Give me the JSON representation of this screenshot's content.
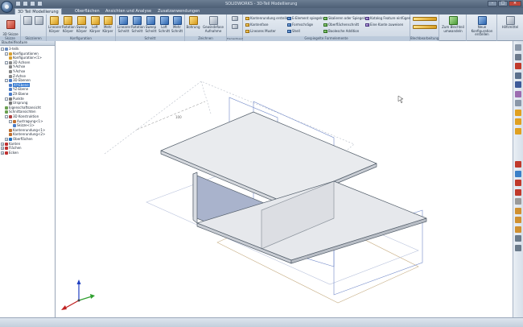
{
  "window": {
    "title": "SOLIDWORKS - 3D-Teil Modellierung",
    "min": "–",
    "max": "□",
    "close": "×"
  },
  "tabs": [
    "3D Teil Modellierung",
    "Oberflächen",
    "Ansichten und Analyse",
    "Zusatzanwendungen"
  ],
  "ribbon": {
    "groups": [
      {
        "label": "Skizze"
      },
      {
        "label": "Skizzieren"
      },
      {
        "label": "Konfiguration"
      },
      {
        "label": "Schnitt"
      },
      {
        "label": "Zeichnen"
      },
      {
        "label": "Elementbearbeitung"
      },
      {
        "label": "Gespiegelte Formelemente"
      },
      {
        "label": "Blechbearbeitung"
      },
      {
        "label": "Hilfsmittel"
      }
    ],
    "sketch_btn": "3D Skizze\naktivieren",
    "buttons_1": [
      "Linearer\nKörper",
      "Rotation\nKörper",
      "Sweep\nKörper",
      "Loft\nKörper",
      "Mehr\nKörper"
    ],
    "buttons_2": [
      "Linearer\nSchnitt",
      "Rotation\nSchnitt",
      "Sweep\nSchnitt",
      "Loft\nSchnitt",
      "Mehr\nSchnitt"
    ],
    "buttons_3": [
      "Bohrung",
      "Gewindefase\nAufnahme"
    ],
    "small_col1": [
      "Kantenrundung erstellen",
      "Kantenfase",
      "Lineares Muster"
    ],
    "small_col2": [
      "E-Element spiegeln",
      "Formschräge",
      "Shell"
    ],
    "small_col3": [
      "Skalieren oder Spiegeln",
      "Oberflächenschnitt",
      "Boolesche Addition"
    ],
    "small_col4": [
      "Katalog Feature einfügen",
      "Eine Kante zuweisen"
    ],
    "sheet_btn": "Zum Blechteil\numwandeln",
    "new_btn": "Neue Konfiguration\nerstellen",
    "tools_btn": "Hilfsmittel"
  },
  "panel": {
    "title": "Bauteilfeature",
    "tree": [
      {
        "label": "3-teilk",
        "indent": 0,
        "exp": "-",
        "color": "#6b8cc0"
      },
      {
        "label": "Konfigurationen",
        "indent": 1,
        "exp": "-",
        "color": "#d8a030"
      },
      {
        "label": "Konfiguration<1>",
        "indent": 2,
        "exp": "",
        "color": "#d8a030"
      },
      {
        "label": "3D Achsen",
        "indent": 1,
        "exp": "-",
        "color": "#888"
      },
      {
        "label": "Y-Achse",
        "indent": 2,
        "exp": "",
        "color": "#888"
      },
      {
        "label": "Y-Achse",
        "indent": 2,
        "exp": "",
        "color": "#888"
      },
      {
        "label": "Z-Achse",
        "indent": 2,
        "exp": "",
        "color": "#888"
      },
      {
        "label": "3D Ebenen",
        "indent": 1,
        "exp": "-",
        "color": "#4a7cc8"
      },
      {
        "label": "XY-Ebene",
        "indent": 2,
        "exp": "",
        "color": "#4a7cc8",
        "sel": true
      },
      {
        "label": "YZ-Ebene",
        "indent": 2,
        "exp": "",
        "color": "#4a7cc8"
      },
      {
        "label": "ZX-Ebene",
        "indent": 2,
        "exp": "",
        "color": "#4a7cc8"
      },
      {
        "label": "Punkte",
        "indent": 1,
        "exp": "-",
        "color": "#777"
      },
      {
        "label": "Ursprung",
        "indent": 2,
        "exp": "",
        "color": "#777"
      },
      {
        "label": "Eigenschaftsansicht",
        "indent": 1,
        "exp": "",
        "color": "#6aa050"
      },
      {
        "label": "Schnittansichten",
        "indent": 1,
        "exp": "",
        "color": "#6aa050"
      },
      {
        "label": "3D Konstruktion",
        "indent": 1,
        "exp": "-",
        "color": "#b04040"
      },
      {
        "label": "Austragung<1>",
        "indent": 2,
        "exp": "-",
        "color": "#c07030"
      },
      {
        "label": "Skizze<1>",
        "indent": 3,
        "exp": "",
        "color": "#4a7cc8"
      },
      {
        "label": "Kantenrundung<1>",
        "indent": 2,
        "exp": "",
        "color": "#c07030"
      },
      {
        "label": "Kantenrundung<2>",
        "indent": 2,
        "exp": "",
        "color": "#c07030"
      },
      {
        "label": "Oberflächen",
        "indent": 1,
        "exp": "+",
        "color": "#2070c0"
      },
      {
        "label": "Kanten",
        "indent": 0,
        "exp": "+",
        "color": "#c03030"
      },
      {
        "label": "Flächen",
        "indent": 0,
        "exp": "+",
        "color": "#c03030"
      },
      {
        "label": "Ecken",
        "indent": 0,
        "exp": "+",
        "color": "#c03030"
      }
    ]
  },
  "viewport": {
    "dim_label": "100",
    "colors": {
      "top": "#e9ebee",
      "side": "#a9b3cc",
      "shade": "#c9cdd4",
      "edge": "#55606c",
      "plane": "#5a78c8",
      "ghost": "#c8b088"
    }
  },
  "right_tools": [
    "view-icon",
    "print-icon",
    "pdf-icon",
    "model-icon",
    "shaded-icon",
    "layers-icon",
    "zoom-icon",
    "cube-icon",
    "cube-icon",
    "cube-icon",
    "measure-icon",
    "arrow-icon",
    "rotate-icon",
    "point-icon",
    "line-icon",
    "arc-icon",
    "circle-icon",
    "circle-icon",
    "grid-icon",
    "fit-icon"
  ]
}
